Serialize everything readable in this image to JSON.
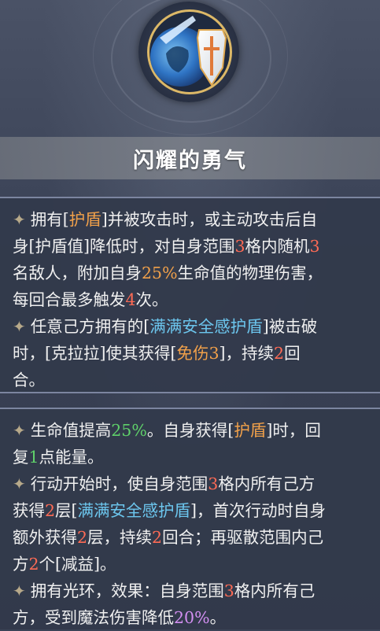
{
  "skill": {
    "title": "闪耀的勇气",
    "icon": "sword-and-shield-icon"
  },
  "section1": [
    {
      "segments": [
        {
          "t": "拥有",
          "c": "white"
        },
        {
          "t": "[",
          "c": "white"
        },
        {
          "t": "护盾",
          "c": "orange"
        },
        {
          "t": "]并被攻击时，或主动攻击后自",
          "c": "white"
        }
      ],
      "star": true
    },
    {
      "segments": [
        {
          "t": "身[护盾值]降低时，对自身范围",
          "c": "white"
        },
        {
          "t": "3",
          "c": "red"
        },
        {
          "t": "格内随机",
          "c": "white"
        },
        {
          "t": "3",
          "c": "red"
        }
      ],
      "star": false
    },
    {
      "segments": [
        {
          "t": "名敌人，附加自身",
          "c": "white"
        },
        {
          "t": "25%",
          "c": "orange"
        },
        {
          "t": "生命值的物理伤害，",
          "c": "white"
        }
      ],
      "star": false
    },
    {
      "segments": [
        {
          "t": "每回合最多触发",
          "c": "white"
        },
        {
          "t": "4",
          "c": "red"
        },
        {
          "t": "次。",
          "c": "white"
        }
      ],
      "star": false
    },
    {
      "segments": [
        {
          "t": "任意己方拥有的[",
          "c": "white"
        },
        {
          "t": "满满安全感护盾",
          "c": "blue"
        },
        {
          "t": "]被击破",
          "c": "white"
        }
      ],
      "star": true
    },
    {
      "segments": [
        {
          "t": "时，[克拉拉]使其获得[",
          "c": "white"
        },
        {
          "t": "免伤3",
          "c": "orange"
        },
        {
          "t": "]，持续",
          "c": "white"
        },
        {
          "t": "2",
          "c": "red"
        },
        {
          "t": "回",
          "c": "white"
        }
      ],
      "star": false
    },
    {
      "segments": [
        {
          "t": "合。",
          "c": "white"
        }
      ],
      "star": false
    }
  ],
  "section2": [
    {
      "segments": [
        {
          "t": "生命值提高",
          "c": "white"
        },
        {
          "t": "25%",
          "c": "green"
        },
        {
          "t": "。自身获得[",
          "c": "white"
        },
        {
          "t": "护盾",
          "c": "orange"
        },
        {
          "t": "]时，回",
          "c": "white"
        }
      ],
      "star": true
    },
    {
      "segments": [
        {
          "t": "复",
          "c": "white"
        },
        {
          "t": "1",
          "c": "green"
        },
        {
          "t": "点能量。",
          "c": "white"
        }
      ],
      "star": false
    },
    {
      "segments": [
        {
          "t": "行动开始时，使自身范围",
          "c": "white"
        },
        {
          "t": "3",
          "c": "red"
        },
        {
          "t": "格内所有己方",
          "c": "white"
        }
      ],
      "star": true
    },
    {
      "segments": [
        {
          "t": "获得",
          "c": "white"
        },
        {
          "t": "2",
          "c": "red"
        },
        {
          "t": "层[",
          "c": "white"
        },
        {
          "t": "满满安全感护盾",
          "c": "blue"
        },
        {
          "t": "]，首次行动时自身",
          "c": "white"
        }
      ],
      "star": false
    },
    {
      "segments": [
        {
          "t": "额外获得",
          "c": "white"
        },
        {
          "t": "2",
          "c": "red"
        },
        {
          "t": "层，持续",
          "c": "white"
        },
        {
          "t": "2",
          "c": "red"
        },
        {
          "t": "回合；再驱散范围内己",
          "c": "white"
        }
      ],
      "star": false
    },
    {
      "segments": [
        {
          "t": "方",
          "c": "white"
        },
        {
          "t": "2",
          "c": "red"
        },
        {
          "t": "个[减益]。",
          "c": "white"
        }
      ],
      "star": false
    },
    {
      "segments": [
        {
          "t": "拥有光环，效果：自身范围",
          "c": "white"
        },
        {
          "t": "3",
          "c": "red"
        },
        {
          "t": "格内所有己",
          "c": "white"
        }
      ],
      "star": true
    },
    {
      "segments": [
        {
          "t": "方，受到魔法伤害降低",
          "c": "white"
        },
        {
          "t": "20%",
          "c": "purple"
        },
        {
          "t": "。",
          "c": "white"
        }
      ],
      "star": false
    }
  ],
  "glyphs": {
    "star": "✦"
  }
}
